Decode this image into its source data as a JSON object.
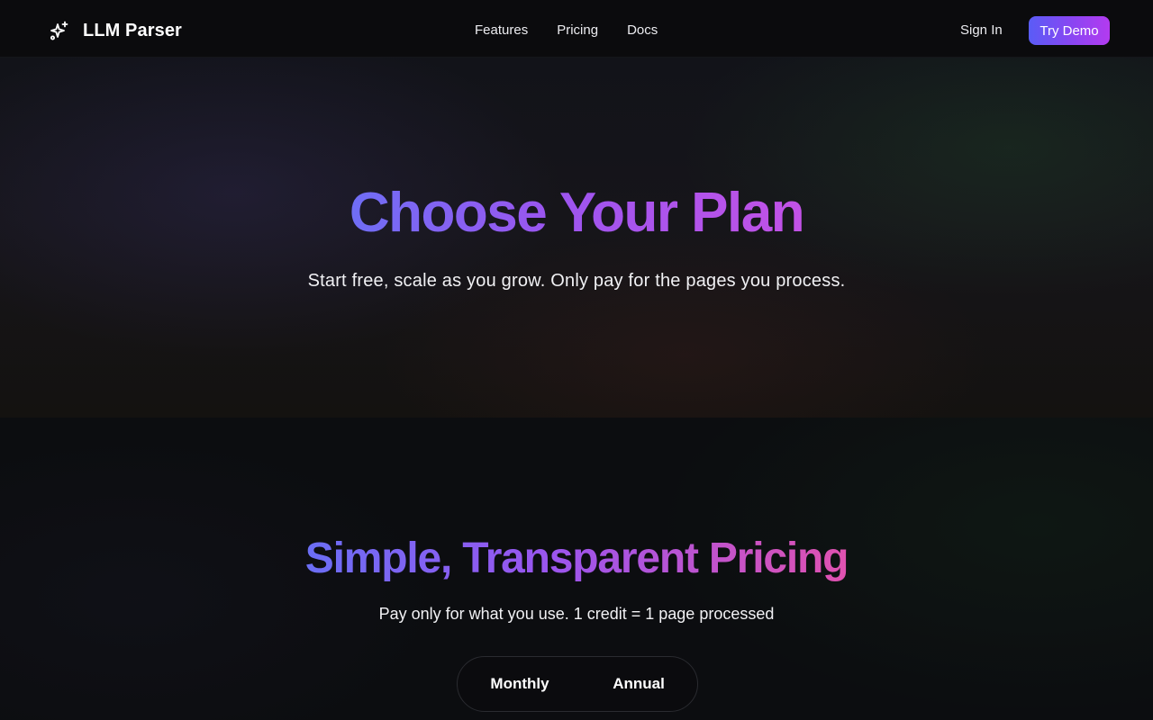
{
  "nav": {
    "brand_name": "LLM Parser",
    "brand_icon": "sparkles-icon",
    "links": [
      "Features",
      "Pricing",
      "Docs"
    ],
    "sign_in": "Sign In",
    "try_demo": "Try Demo"
  },
  "hero": {
    "title": "Choose Your Plan",
    "subtitle": "Start free, scale as you grow. Only pay for the pages you process."
  },
  "pricing": {
    "title": "Simple, Transparent Pricing",
    "subtitle": "Pay only for what you use. 1 credit = 1 page processed",
    "billing_options": [
      "Monthly",
      "Annual"
    ]
  },
  "colors": {
    "accent_start": "#5a5cf6",
    "accent_end": "#b33bf0",
    "background": "#0c0d10"
  }
}
